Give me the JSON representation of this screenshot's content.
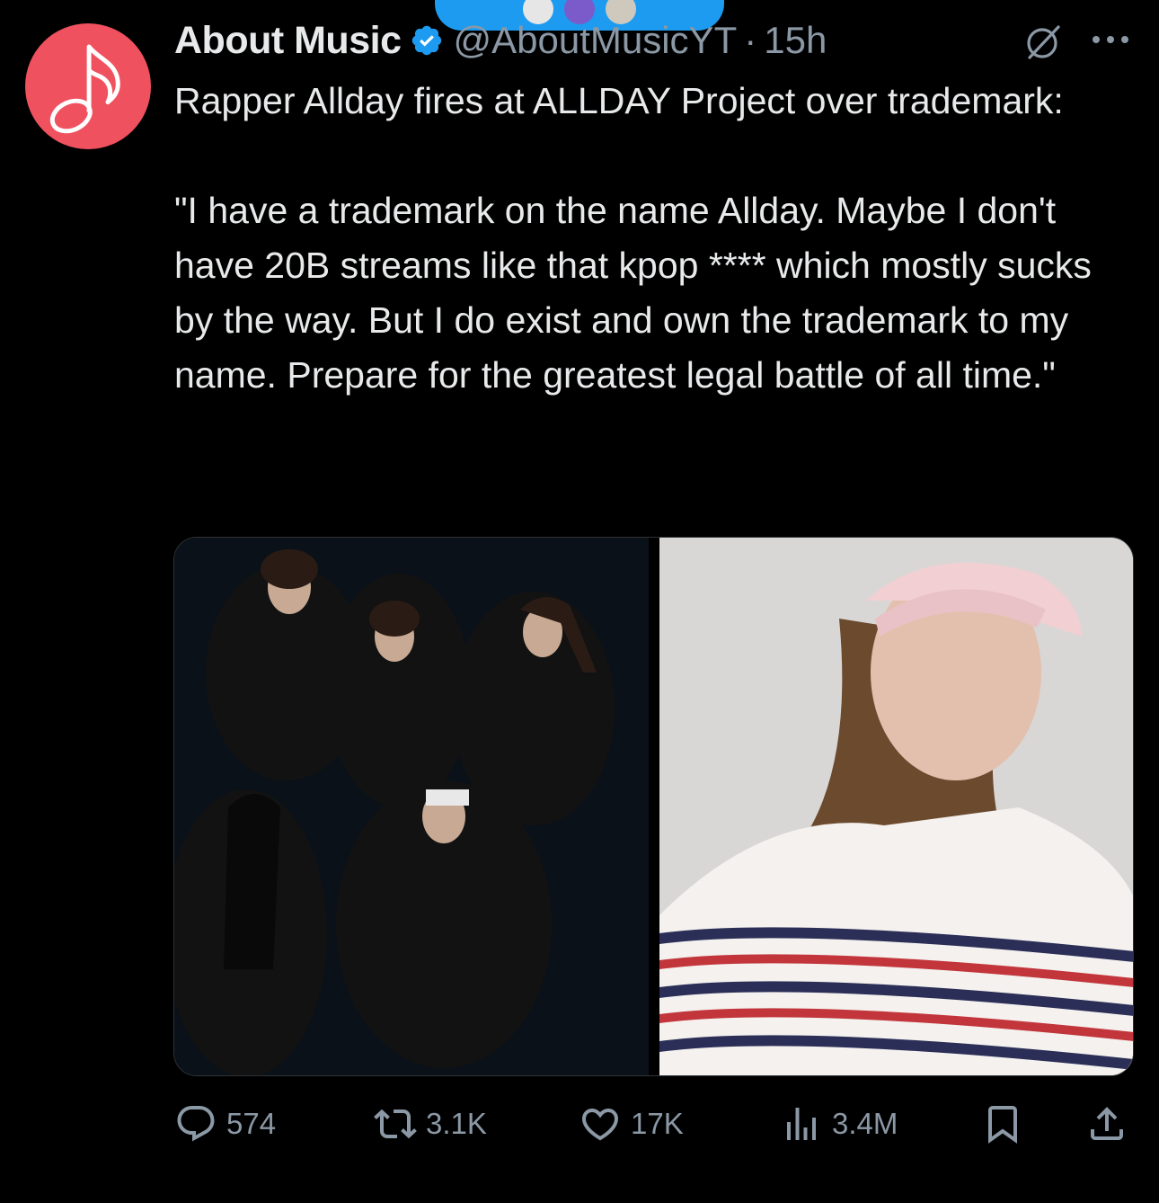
{
  "tweet": {
    "author": {
      "display_name": "About Music",
      "handle": "@AboutMusicYT",
      "separator": "·",
      "time": "15h",
      "avatar_glyph": "♪",
      "avatar_color": "#f0515f",
      "verified": true
    },
    "text": "Rapper Allday fires at ALLDAY Project over trademark:\n\n\"I have a trademark on the name Allday. Maybe I don't have 20B streams like that kpop **** which mostly sucks by the way. But I do exist and own the trademark to my name. Prepare for the greatest legal battle of all time.\"",
    "media": [
      {
        "icon": "group-photo"
      },
      {
        "icon": "portrait-photo"
      }
    ],
    "stats": {
      "replies": "574",
      "reposts": "3.1K",
      "likes": "17K",
      "views": "3.4M"
    }
  },
  "colors": {
    "background": "#000000",
    "text_primary": "#e7e9ea",
    "text_secondary": "#8b98a5",
    "accent": "#1d9bf0"
  }
}
